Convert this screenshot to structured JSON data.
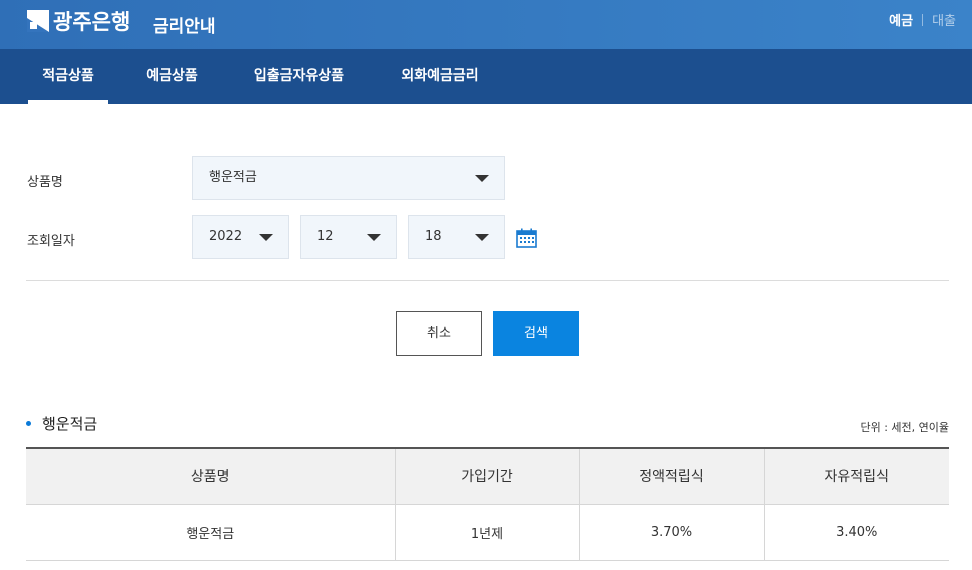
{
  "header": {
    "logo_text": "광주은행",
    "page_title": "금리안내",
    "util": {
      "deposit": "예금",
      "loan": "대출"
    }
  },
  "nav": {
    "tabs": [
      {
        "label": "적금상품",
        "active": true
      },
      {
        "label": "예금상품",
        "active": false
      },
      {
        "label": "입출금자유상품",
        "active": false
      },
      {
        "label": "외화예금금리",
        "active": false
      }
    ]
  },
  "form": {
    "product_label": "상품명",
    "product_value": "행운적금",
    "date_label": "조회일자",
    "year": "2022",
    "month": "12",
    "day": "18"
  },
  "buttons": {
    "cancel": "취소",
    "search": "검색"
  },
  "result": {
    "title": "행운적금",
    "unit": "단위 : 세전, 연이율",
    "columns": [
      "상품명",
      "가입기간",
      "정액적립식",
      "자유적립식"
    ],
    "rows": [
      [
        "행운적금",
        "1년제",
        "3.70%",
        "3.40%"
      ]
    ]
  },
  "colors": {
    "header": "#3474bd",
    "nav": "#1c4f8f",
    "primary_button": "#0a84e0"
  }
}
